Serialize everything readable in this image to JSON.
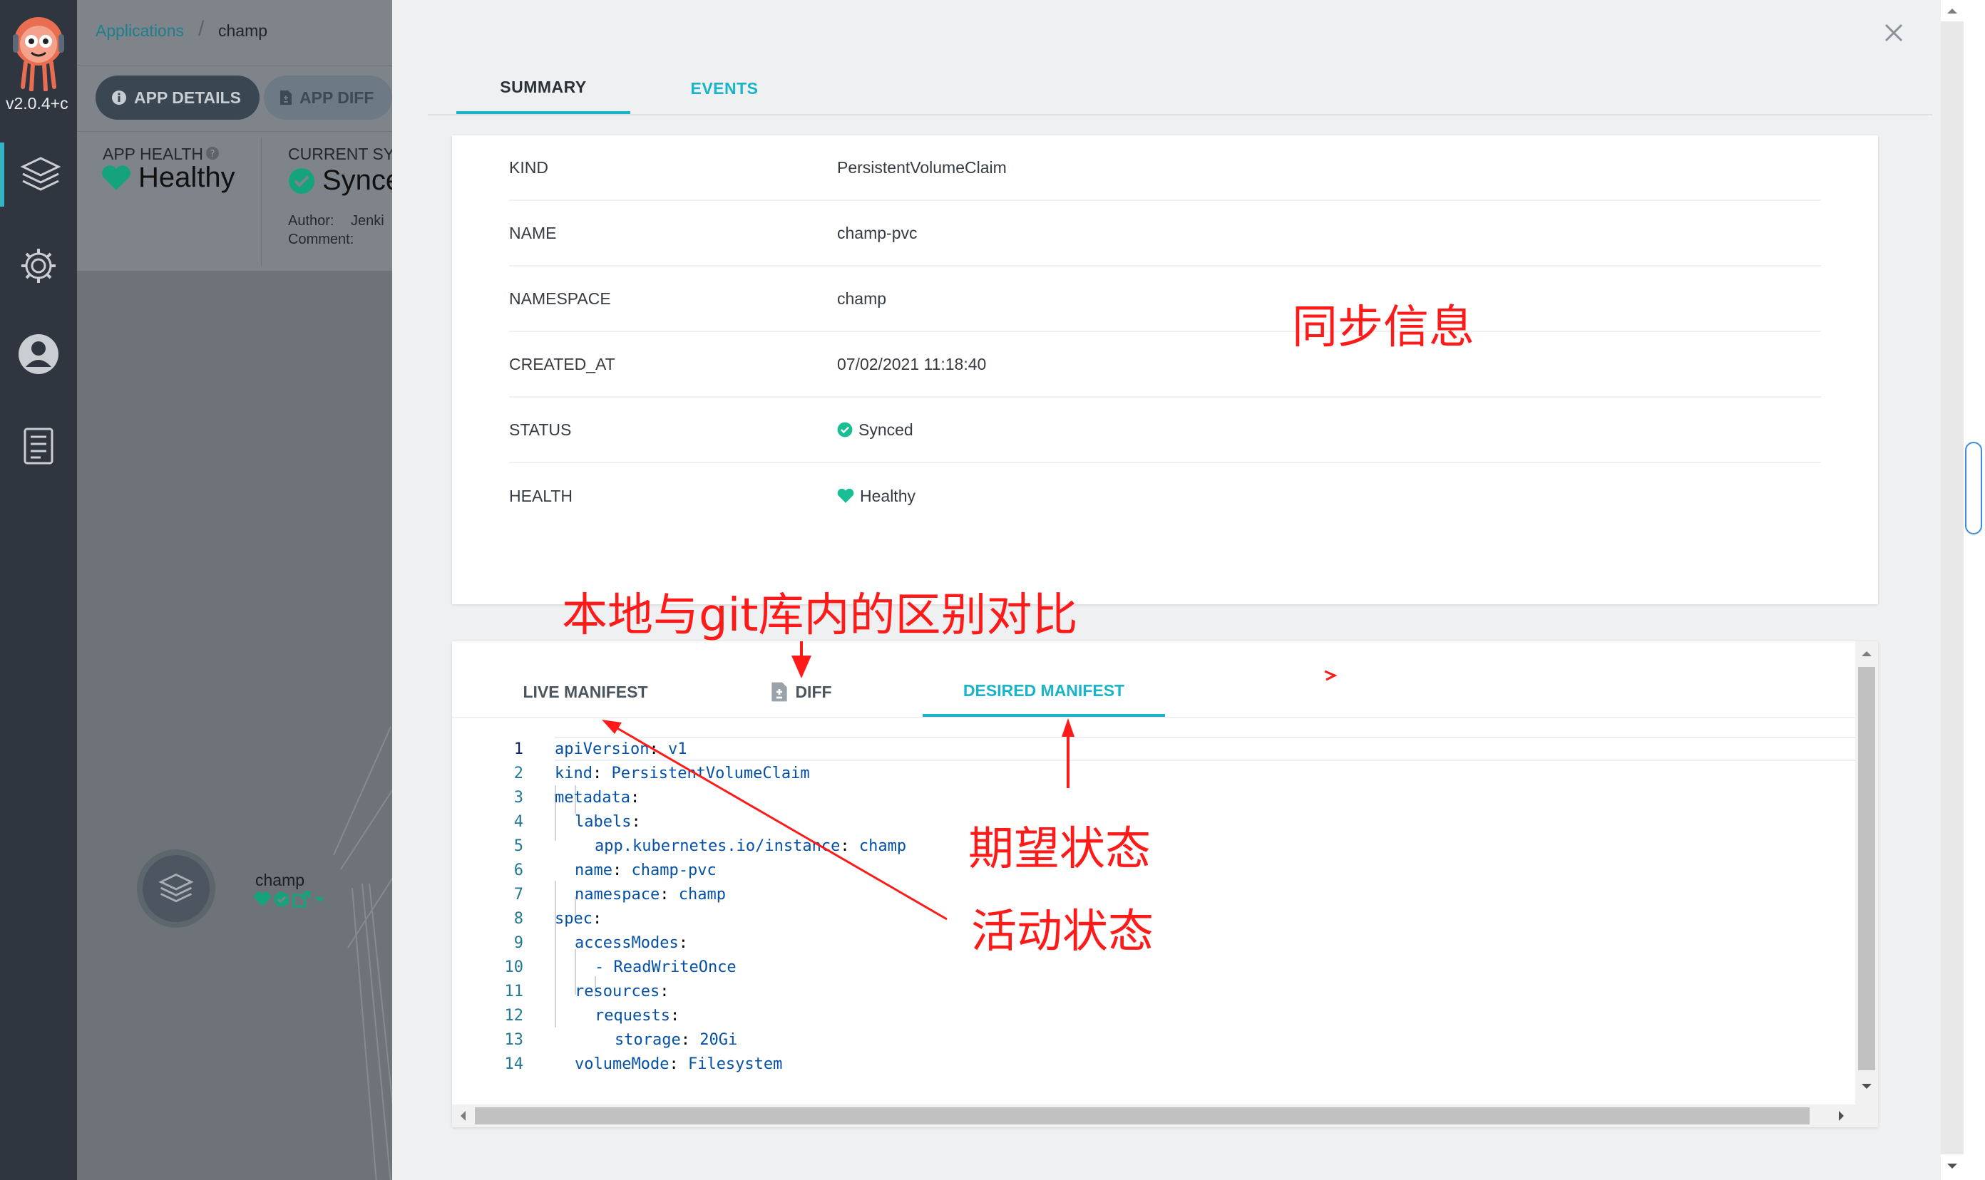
{
  "nav": {
    "version": "v2.0.4+c",
    "items": [
      "applications-icon",
      "settings-icon",
      "user-icon",
      "docs-icon"
    ]
  },
  "background": {
    "breadcrumb": {
      "root": "Applications",
      "current": "champ"
    },
    "buttons": {
      "details": "APP DETAILS",
      "diff": "APP DIFF"
    },
    "health": {
      "label": "APP HEALTH",
      "value": "Healthy"
    },
    "sync": {
      "label": "CURRENT SYN",
      "value": "Synce",
      "author_label": "Author:",
      "author_value": "Jenki",
      "comment_label": "Comment:"
    },
    "graph_node": {
      "name": "champ"
    }
  },
  "panel": {
    "tabs": {
      "summary": "SUMMARY",
      "events": "EVENTS"
    },
    "summary": [
      {
        "key": "KIND",
        "value": "PersistentVolumeClaim"
      },
      {
        "key": "NAME",
        "value": "champ-pvc"
      },
      {
        "key": "NAMESPACE",
        "value": "champ"
      },
      {
        "key": "CREATED_AT",
        "value": "07/02/2021 11:18:40"
      },
      {
        "key": "STATUS",
        "value": "Synced"
      },
      {
        "key": "HEALTH",
        "value": "Healthy"
      }
    ],
    "manifest_tabs": {
      "live": "LIVE MANIFEST",
      "diff": "DIFF",
      "desired": "DESIRED MANIFEST"
    },
    "code_lines": [
      {
        "n": "1",
        "k": "apiVersion",
        "v": "v1"
      },
      {
        "n": "2",
        "k": "kind",
        "v": "PersistentVolumeClaim"
      },
      {
        "n": "3",
        "k": "metadata",
        "v": ""
      },
      {
        "n": "4",
        "k": "labels",
        "v": ""
      },
      {
        "n": "5",
        "k": "app.kubernetes.io/instance",
        "v": "champ"
      },
      {
        "n": "6",
        "k": "name",
        "v": "champ-pvc"
      },
      {
        "n": "7",
        "k": "namespace",
        "v": "champ"
      },
      {
        "n": "8",
        "k": "spec",
        "v": ""
      },
      {
        "n": "9",
        "k": "accessModes",
        "v": ""
      },
      {
        "n": "10",
        "k": "- ReadWriteOnce",
        "v": ""
      },
      {
        "n": "11",
        "k": "resources",
        "v": ""
      },
      {
        "n": "12",
        "k": "requests",
        "v": ""
      },
      {
        "n": "13",
        "k": "storage",
        "v": "20Gi"
      },
      {
        "n": "14",
        "k": "volumeMode",
        "v": "Filesystem"
      }
    ]
  },
  "annotations": {
    "sync_info": "同步信息",
    "local_vs_git": "本地与git库内的区别对比",
    "desired_state": "期望状态",
    "live_state": "活动状态"
  },
  "colors": {
    "accent": "#19b4c8",
    "health": "#18be94",
    "annotation": "#ff1a1a",
    "nav": "#2f3640"
  }
}
